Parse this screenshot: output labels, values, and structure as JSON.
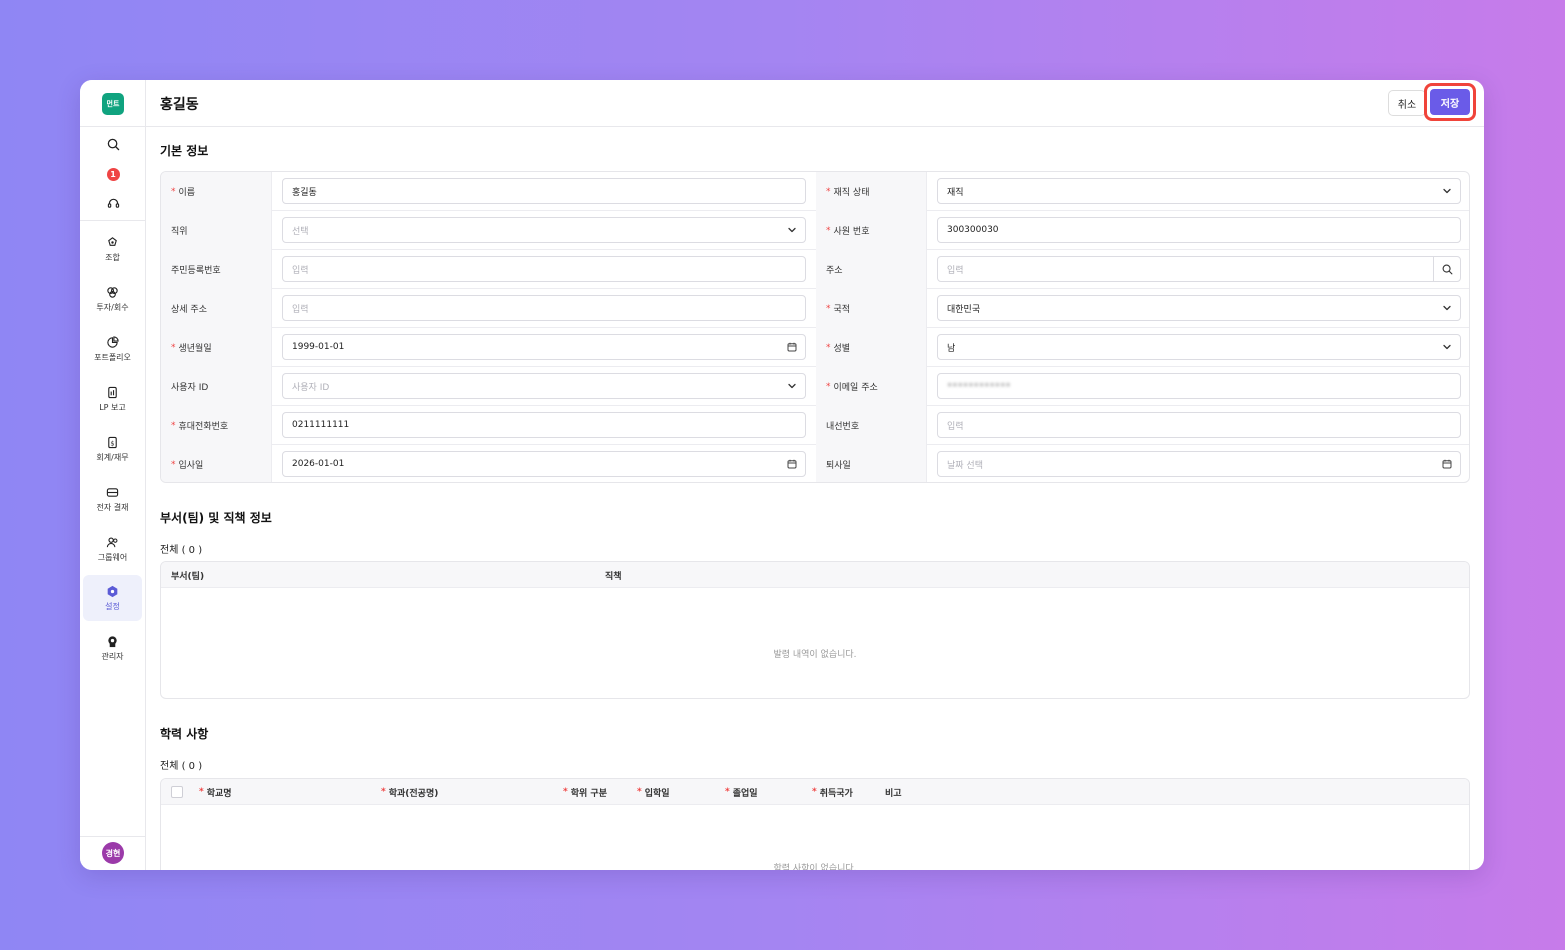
{
  "app": {
    "logo_text": "먼트",
    "page_title": "홍길동",
    "notification_count": "1",
    "avatar_text": "경현",
    "brand_color": "#10a37f",
    "accent_color": "#6a5be8",
    "highlight_color": "#f0443a"
  },
  "header": {
    "cancel_label": "취소",
    "save_label": "저장"
  },
  "sidebar": {
    "top_icons": [
      "search-icon",
      "notification-badge",
      "headset-icon"
    ],
    "items": [
      {
        "label": "조합",
        "icon": "union-icon"
      },
      {
        "label": "투자/회수",
        "icon": "investment-icon"
      },
      {
        "label": "포트폴리오",
        "icon": "portfolio-icon"
      },
      {
        "label": "LP 보고",
        "icon": "report-icon"
      },
      {
        "label": "회계/재무",
        "icon": "finance-icon"
      },
      {
        "label": "전자 결재",
        "icon": "approval-icon"
      },
      {
        "label": "그룹웨어",
        "icon": "groupware-icon"
      },
      {
        "label": "설정",
        "icon": "settings-icon"
      },
      {
        "label": "관리자",
        "icon": "admin-icon"
      }
    ],
    "active_item": "설정"
  },
  "basic_info": {
    "title": "기본 정보",
    "left": [
      {
        "label": "이름",
        "required": true,
        "value": "홍길동",
        "placeholder": "",
        "type": "text"
      },
      {
        "label": "직위",
        "required": false,
        "value": "",
        "placeholder": "선택",
        "type": "select"
      },
      {
        "label": "주민등록번호",
        "required": false,
        "value": "",
        "placeholder": "입력",
        "type": "text"
      },
      {
        "label": "상세 주소",
        "required": false,
        "value": "",
        "placeholder": "입력",
        "type": "text"
      },
      {
        "label": "생년월일",
        "required": true,
        "value": "1999-01-01",
        "placeholder": "",
        "type": "date"
      },
      {
        "label": "사용자 ID",
        "required": false,
        "value": "",
        "placeholder": "사용자 ID",
        "type": "select"
      },
      {
        "label": "휴대전화번호",
        "required": true,
        "value": "0211111111",
        "placeholder": "",
        "type": "text"
      },
      {
        "label": "입사일",
        "required": true,
        "value": "2026-01-01",
        "placeholder": "",
        "type": "date"
      }
    ],
    "right": [
      {
        "label": "재직 상태",
        "required": true,
        "value": "재직",
        "placeholder": "",
        "type": "select"
      },
      {
        "label": "사원 번호",
        "required": true,
        "value": "300300030",
        "placeholder": "",
        "type": "text"
      },
      {
        "label": "주소",
        "required": false,
        "value": "",
        "placeholder": "입력",
        "type": "search"
      },
      {
        "label": "국적",
        "required": true,
        "value": "대한민국",
        "placeholder": "",
        "type": "select"
      },
      {
        "label": "성별",
        "required": true,
        "value": "남",
        "placeholder": "",
        "type": "select"
      },
      {
        "label": "이메일 주소",
        "required": true,
        "value": "",
        "placeholder": "",
        "type": "blurred"
      },
      {
        "label": "내선번호",
        "required": false,
        "value": "",
        "placeholder": "입력",
        "type": "text"
      },
      {
        "label": "퇴사일",
        "required": false,
        "value": "",
        "placeholder": "날짜 선택",
        "type": "date"
      }
    ]
  },
  "department": {
    "title": "부서(팀) 및 직책 정보",
    "count_label": "전체 ( 0 )",
    "columns": [
      "부서(팀)",
      "직책"
    ],
    "empty_message": "발령 내역이 없습니다."
  },
  "education": {
    "title": "학력 사항",
    "count_label": "전체 ( 0 )",
    "columns": [
      {
        "label": "학교명",
        "required": true
      },
      {
        "label": "학과(전공명)",
        "required": true
      },
      {
        "label": "학위 구분",
        "required": true
      },
      {
        "label": "입학일",
        "required": true
      },
      {
        "label": "졸업일",
        "required": true
      },
      {
        "label": "취득국가",
        "required": true
      },
      {
        "label": "비고",
        "required": false
      }
    ],
    "empty_message": "학력 사항이 없습니다."
  }
}
